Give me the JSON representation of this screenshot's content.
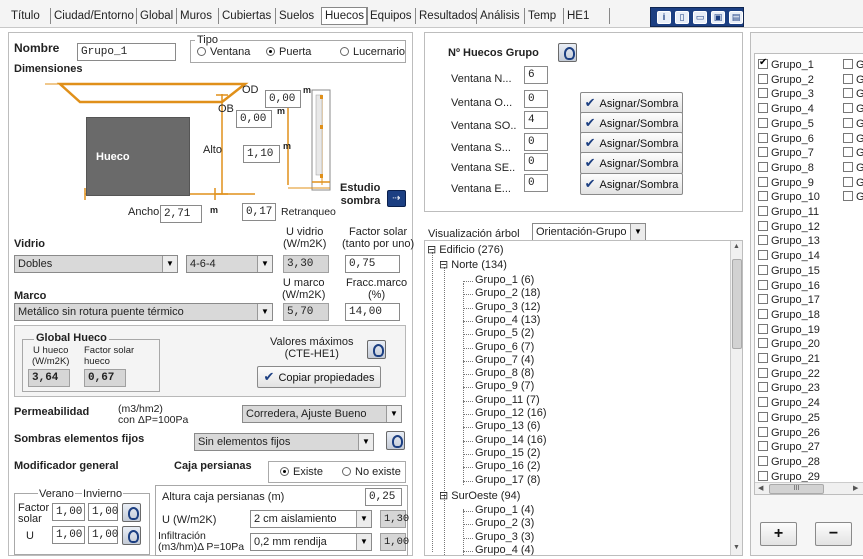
{
  "tabs": [
    "Título",
    "Ciudad/Entorno",
    "Global",
    "Muros",
    "Cubiertas",
    "Suelos",
    "Huecos",
    "Equipos",
    "Resultados",
    "Análisis",
    "Temp",
    "HE1"
  ],
  "active_tab": "Huecos",
  "toolbar_icons": [
    "info-icon",
    "doc-icon",
    "folder-icon",
    "save-icon",
    "export-icon"
  ],
  "nombre": {
    "label": "Nombre",
    "value": "Grupo_1"
  },
  "tipo": {
    "label": "Tipo",
    "options": [
      "Ventana",
      "Puerta",
      "Lucernario"
    ],
    "selected": "Puerta"
  },
  "dimensiones": {
    "label": "Dimensiones",
    "od_label": "OD",
    "od_value": "0,00",
    "ob_label": "OB",
    "ob_value": "0,00",
    "m": "m",
    "hueco_label": "Hueco",
    "alto_label": "Alto",
    "alto_value": "1,10",
    "ancho_label": "Ancho",
    "ancho_value": "2,71",
    "retranqueo_value": "0,17",
    "retranqueo_label": "Retranqueo",
    "estudio_sombra": "Estudio\nsombra"
  },
  "vidrio": {
    "label": "Vidrio",
    "uvidrio_header": "U vidrio\n(W/m2K)",
    "factor_header": "Factor solar\n(tanto por uno)",
    "type": "Dobles",
    "composition": "4-6-4",
    "u": "3,30",
    "factor": "0,75"
  },
  "marco": {
    "label": "Marco",
    "umarco_header": "U marco\n(W/m2K)",
    "fracc_header": "Fracc.marco\n(%)",
    "type": "Metálico sin rotura puente térmico",
    "u": "5,70",
    "fracc": "14,00"
  },
  "global_hueco": {
    "label": "Global Hueco",
    "u_label": "U hueco\n(W/m2K)",
    "f_label": "Factor solar\nhueco",
    "u": "3,64",
    "f": "0,67",
    "valores_max": "Valores máximos\n(CTE-HE1)",
    "copiar": "Copiar propiedades"
  },
  "permeabilidad": {
    "label": "Permeabilidad",
    "units": "(m3/hm2)\ncon ΔP=100Pa",
    "value": "Corredera, Ajuste Bueno"
  },
  "sombras": {
    "label": "Sombras elementos fijos",
    "value": "Sin elementos fijos"
  },
  "modificador": {
    "label": "Modificador general",
    "caja_label": "Caja persianas",
    "options": [
      "Existe",
      "No existe"
    ],
    "selected": "Existe"
  },
  "verano_invierno": {
    "verano": "Verano",
    "invierno": "Invierno",
    "factor_label": "Factor\nsolar",
    "u_label": "U",
    "factor_verano": "1,00",
    "factor_invierno": "1,00",
    "u_verano": "1,00",
    "u_invierno": "1,00"
  },
  "caja": {
    "altura_label": "Altura caja persianas (m)",
    "altura": "0,25",
    "u_label": "U (W/m2K)",
    "u_type": "2 cm aislamiento",
    "u_value": "1,30",
    "infil_label": "Infiltración\n(m3/hm)Δ P=10Pa",
    "infil_type": "0,2 mm rendija",
    "infil_value": "1,00"
  },
  "huecos_grupo": {
    "title": "Nº Huecos Grupo",
    "rows": [
      {
        "label": "Ventana N...",
        "value": "6"
      },
      {
        "label": "Ventana O...",
        "value": "0"
      },
      {
        "label": "Ventana SO..",
        "value": "4"
      },
      {
        "label": "Ventana S...",
        "value": "0"
      },
      {
        "label": "Ventana SE..",
        "value": "0"
      },
      {
        "label": "Ventana E...",
        "value": "0"
      }
    ],
    "assign_label": "Asignar/Sombra"
  },
  "arbol": {
    "label": "Visualización árbol",
    "mode": "Orientación-Grupo",
    "root": "Edificio  (276)",
    "norte": "Norte  (134)",
    "norte_items": [
      "Grupo_1  (6)",
      "Grupo_2  (18)",
      "Grupo_3  (12)",
      "Grupo_4  (13)",
      "Grupo_5  (2)",
      "Grupo_6  (7)",
      "Grupo_7  (4)",
      "Grupo_8  (8)",
      "Grupo_9  (7)",
      "Grupo_11  (7)",
      "Grupo_12  (16)",
      "Grupo_13  (6)",
      "Grupo_14  (16)",
      "Grupo_15  (2)",
      "Grupo_16  (2)",
      "Grupo_17  (8)"
    ],
    "suroeste": "SurOeste  (94)",
    "suroeste_items": [
      "Grupo_1  (4)",
      "Grupo_2  (3)",
      "Grupo_3  (3)",
      "Grupo_4  (4)"
    ]
  },
  "group_list": {
    "items": [
      "Grupo_1",
      "Grupo_2",
      "Grupo_3",
      "Grupo_4",
      "Grupo_5",
      "Grupo_6",
      "Grupo_7",
      "Grupo_8",
      "Grupo_9",
      "Grupo_10",
      "Grupo_11",
      "Grupo_12",
      "Grupo_13",
      "Grupo_14",
      "Grupo_15",
      "Grupo_16",
      "Grupo_17",
      "Grupo_18",
      "Grupo_19",
      "Grupo_20",
      "Grupo_21",
      "Grupo_22",
      "Grupo_23",
      "Grupo_24",
      "Grupo_25",
      "Grupo_26",
      "Grupo_27",
      "Grupo_28",
      "Grupo_29"
    ],
    "checked": "Grupo_1",
    "second_col": "Gr",
    "add": "+",
    "remove": "−",
    "scroll_glyph": "III"
  }
}
